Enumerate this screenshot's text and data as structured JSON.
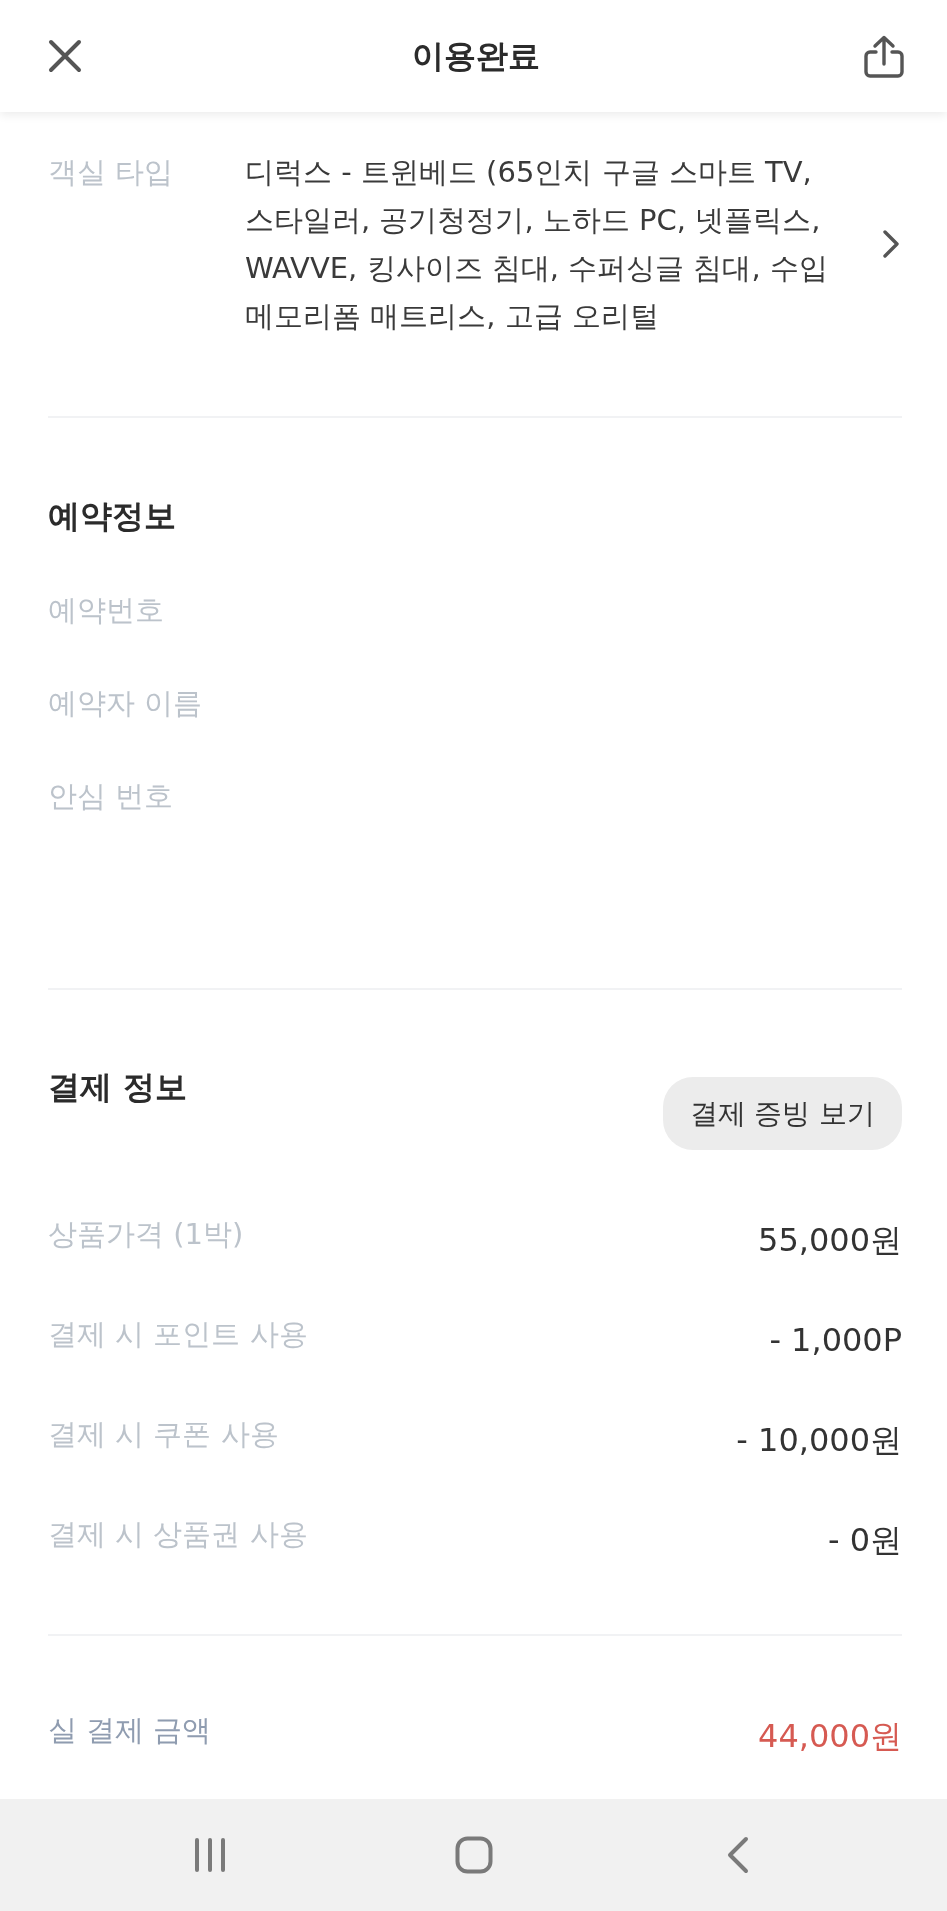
{
  "header": {
    "title": "이용완료"
  },
  "room": {
    "label": "객실 타입",
    "value": "디럭스 - 트윈베드 (65인치 구글 스마트 TV, 스타일러, 공기청정기, 노하드 PC, 넷플릭스, WAVVE, 킹사이즈 침대, 수퍼싱글 침대, 수입 메모리폼 매트리스, 고급 오리털"
  },
  "reservation": {
    "title": "예약정보",
    "fields": [
      {
        "label": "예약번호"
      },
      {
        "label": "예약자 이름"
      },
      {
        "label": "안심 번호"
      }
    ]
  },
  "payment": {
    "title": "결제 정보",
    "receipt_button": "결제 증빙 보기",
    "rows": [
      {
        "label": "상품가격 (1박)",
        "value": "55,000원"
      },
      {
        "label": "결제 시 포인트 사용",
        "value": "- 1,000P"
      },
      {
        "label": "결제 시 쿠폰 사용",
        "value": "- 10,000원"
      },
      {
        "label": "결제 시 상품권 사용",
        "value": "- 0원"
      }
    ]
  },
  "total": {
    "label": "실 결제 금액",
    "value": "44,000원"
  }
}
